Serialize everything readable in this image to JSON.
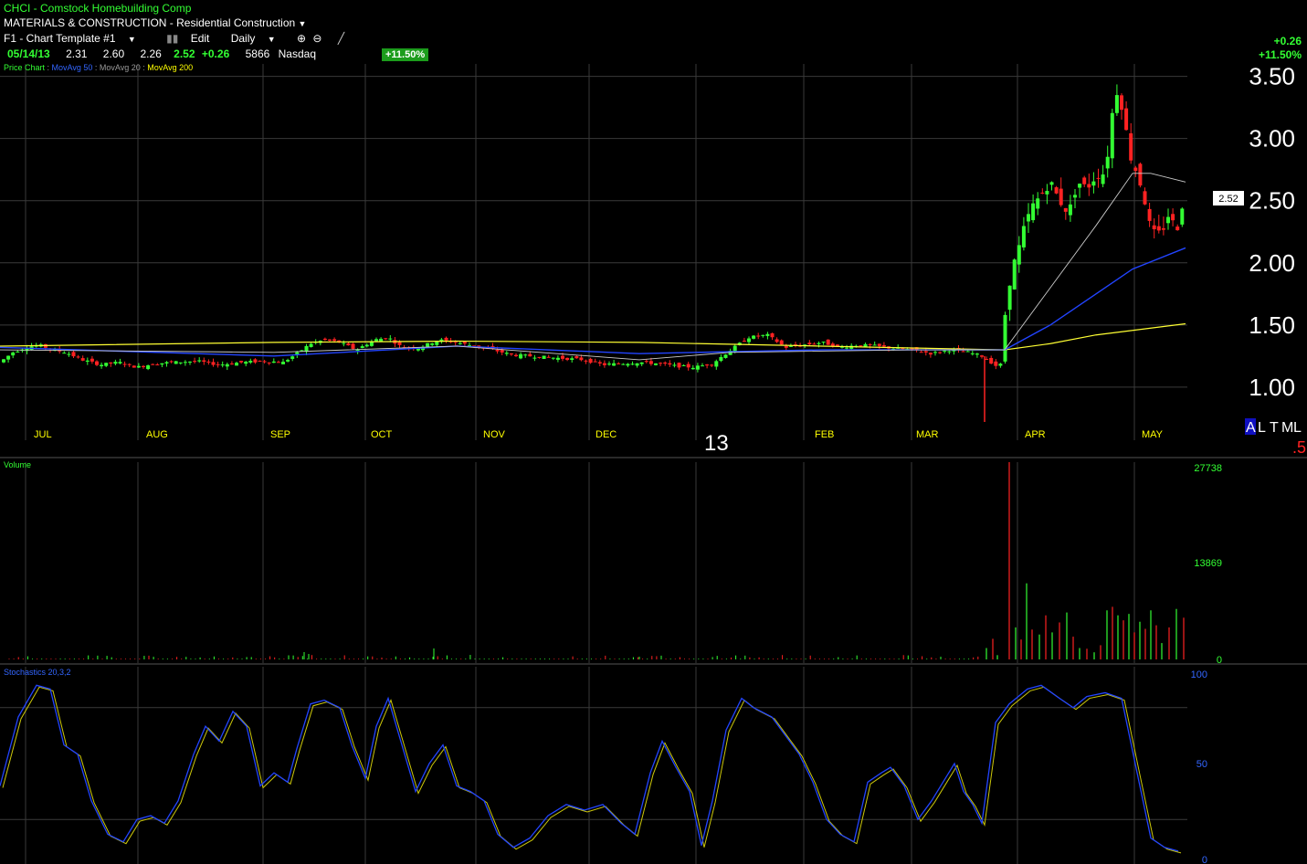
{
  "header": {
    "symbol_line": "CHCI - Comstock Homebuilding Comp",
    "sector_line": "MATERIALS & CONSTRUCTION - Residential Construction",
    "template": "F1 - Chart Template #1",
    "edit_label": "Edit",
    "period": "Daily",
    "date": "05/14/13",
    "open": "2.31",
    "high": "2.60",
    "low": "2.26",
    "close": "2.52",
    "change": "+0.26",
    "volume": "5866",
    "exchange": "Nasdaq",
    "pct_badge": "+11.50%",
    "right_change": "+0.26",
    "right_pct": "+11.50%"
  },
  "legend": {
    "price_chart": "Price Chart",
    "ma50": "MovAvg 50",
    "ma20": "MovAvg 20",
    "ma200": "MovAvg 200",
    "volume_label": "Volume",
    "stoch_label": "Stochastics 20,3,2"
  },
  "colors": {
    "up": "#33ff33",
    "down": "#ff2222",
    "ma50": "#2244ff",
    "ma20": "#cccccc",
    "ma200": "#ffff33",
    "grid": "#3a3a3a"
  },
  "axis": {
    "price_ticks": [
      "3.50",
      "3.00",
      "2.50",
      "2.00",
      "1.50",
      "1.00"
    ],
    "last_price_tag": "2.52",
    "months": [
      "JUL",
      "AUG",
      "SEP",
      "OCT",
      "NOV",
      "DEC",
      "FEB",
      "MAR",
      "APR",
      "MAY"
    ],
    "year_marker": "13",
    "scale_buttons": [
      "A",
      "L",
      "T",
      "M",
      "L"
    ],
    "scale_value": ".5",
    "volume_ticks": [
      "27738",
      "13869",
      "0"
    ],
    "stoch_ticks": [
      "100",
      "50",
      "0"
    ]
  },
  "chart_data": {
    "type": "candlestick",
    "price_range": [
      0.72,
      3.6
    ],
    "volume_range": [
      0,
      27738
    ],
    "stochastics_range": [
      0,
      100
    ],
    "price_path": [
      [
        0,
        1.2
      ],
      [
        14,
        1.28
      ],
      [
        28,
        1.32
      ],
      [
        42,
        1.34
      ],
      [
        58,
        1.3
      ],
      [
        72,
        1.28
      ],
      [
        90,
        1.22
      ],
      [
        110,
        1.18
      ],
      [
        130,
        1.2
      ],
      [
        150,
        1.16
      ],
      [
        170,
        1.19
      ],
      [
        190,
        1.2
      ],
      [
        215,
        1.21
      ],
      [
        240,
        1.18
      ],
      [
        265,
        1.2
      ],
      [
        290,
        1.21
      ],
      [
        310,
        1.2
      ],
      [
        325,
        1.27
      ],
      [
        340,
        1.35
      ],
      [
        355,
        1.38
      ],
      [
        372,
        1.36
      ],
      [
        390,
        1.3
      ],
      [
        410,
        1.38
      ],
      [
        425,
        1.4
      ],
      [
        440,
        1.32
      ],
      [
        460,
        1.32
      ],
      [
        480,
        1.38
      ],
      [
        500,
        1.36
      ],
      [
        520,
        1.33
      ],
      [
        540,
        1.3
      ],
      [
        560,
        1.26
      ],
      [
        580,
        1.25
      ],
      [
        600,
        1.24
      ],
      [
        620,
        1.23
      ],
      [
        640,
        1.22
      ],
      [
        660,
        1.18
      ],
      [
        680,
        1.19
      ],
      [
        700,
        1.2
      ],
      [
        720,
        1.19
      ],
      [
        740,
        1.17
      ],
      [
        760,
        1.16
      ],
      [
        780,
        1.19
      ],
      [
        800,
        1.3
      ],
      [
        820,
        1.4
      ],
      [
        840,
        1.42
      ],
      [
        860,
        1.32
      ],
      [
        880,
        1.34
      ],
      [
        900,
        1.36
      ],
      [
        920,
        1.32
      ],
      [
        940,
        1.34
      ],
      [
        960,
        1.33
      ],
      [
        980,
        1.31
      ],
      [
        1000,
        1.3
      ],
      [
        1020,
        1.27
      ],
      [
        1040,
        1.3
      ],
      [
        1060,
        1.28
      ],
      [
        1075,
        1.25
      ],
      [
        1085,
        1.2
      ],
      [
        1095,
        1.15
      ],
      [
        1102,
        1.7
      ],
      [
        1108,
        1.95
      ],
      [
        1115,
        2.1
      ],
      [
        1122,
        2.3
      ],
      [
        1130,
        2.45
      ],
      [
        1140,
        2.55
      ],
      [
        1150,
        2.65
      ],
      [
        1160,
        2.5
      ],
      [
        1170,
        2.4
      ],
      [
        1180,
        2.65
      ],
      [
        1190,
        2.6
      ],
      [
        1200,
        2.7
      ],
      [
        1208,
        2.72
      ],
      [
        1215,
        2.95
      ],
      [
        1220,
        3.4
      ],
      [
        1226,
        3.35
      ],
      [
        1232,
        3.1
      ],
      [
        1238,
        2.85
      ],
      [
        1245,
        2.72
      ],
      [
        1252,
        2.55
      ],
      [
        1258,
        2.32
      ],
      [
        1265,
        2.22
      ],
      [
        1272,
        2.25
      ],
      [
        1280,
        2.4
      ],
      [
        1288,
        2.25
      ],
      [
        1296,
        2.52
      ]
    ],
    "ma20_path": [
      [
        0,
        1.3
      ],
      [
        300,
        1.28
      ],
      [
        500,
        1.33
      ],
      [
        700,
        1.22
      ],
      [
        800,
        1.28
      ],
      [
        1000,
        1.3
      ],
      [
        1100,
        1.3
      ],
      [
        1150,
        1.8
      ],
      [
        1200,
        2.3
      ],
      [
        1240,
        2.72
      ],
      [
        1260,
        2.72
      ],
      [
        1298,
        2.65
      ]
    ],
    "ma50_path": [
      [
        0,
        1.32
      ],
      [
        300,
        1.25
      ],
      [
        500,
        1.33
      ],
      [
        700,
        1.27
      ],
      [
        900,
        1.3
      ],
      [
        1100,
        1.3
      ],
      [
        1150,
        1.5
      ],
      [
        1200,
        1.75
      ],
      [
        1240,
        1.95
      ],
      [
        1298,
        2.12
      ]
    ],
    "ma200_path": [
      [
        0,
        1.33
      ],
      [
        300,
        1.36
      ],
      [
        500,
        1.37
      ],
      [
        700,
        1.36
      ],
      [
        900,
        1.33
      ],
      [
        1100,
        1.3
      ],
      [
        1150,
        1.35
      ],
      [
        1200,
        1.42
      ],
      [
        1298,
        1.51
      ]
    ],
    "volume_spikes": [
      [
        1080,
        1600
      ],
      [
        1087,
        2900
      ],
      [
        1092,
        600
      ],
      [
        1105,
        27738
      ],
      [
        1112,
        4500
      ],
      [
        1118,
        2800
      ],
      [
        1124,
        10700
      ],
      [
        1130,
        4200
      ],
      [
        1138,
        3500
      ],
      [
        1145,
        6200
      ],
      [
        1152,
        3800
      ],
      [
        1160,
        5200
      ],
      [
        1168,
        6600
      ],
      [
        1175,
        3200
      ],
      [
        1182,
        1600
      ],
      [
        1190,
        1500
      ],
      [
        1198,
        1000
      ],
      [
        1205,
        2000
      ],
      [
        1212,
        6900
      ],
      [
        1218,
        7400
      ],
      [
        1224,
        6200
      ],
      [
        1230,
        5500
      ],
      [
        1236,
        6400
      ],
      [
        1242,
        3800
      ],
      [
        1248,
        5300
      ],
      [
        1254,
        4300
      ],
      [
        1260,
        6900
      ],
      [
        1266,
        4800
      ],
      [
        1272,
        2300
      ],
      [
        1280,
        4500
      ],
      [
        1288,
        7100
      ],
      [
        1296,
        5866
      ]
    ],
    "stochastics_path": [
      [
        0,
        38
      ],
      [
        20,
        75
      ],
      [
        40,
        92
      ],
      [
        55,
        90
      ],
      [
        70,
        60
      ],
      [
        85,
        55
      ],
      [
        100,
        30
      ],
      [
        118,
        12
      ],
      [
        135,
        8
      ],
      [
        150,
        20
      ],
      [
        165,
        22
      ],
      [
        180,
        18
      ],
      [
        195,
        30
      ],
      [
        212,
        55
      ],
      [
        225,
        70
      ],
      [
        240,
        62
      ],
      [
        255,
        78
      ],
      [
        270,
        70
      ],
      [
        285,
        38
      ],
      [
        300,
        45
      ],
      [
        315,
        40
      ],
      [
        325,
        58
      ],
      [
        340,
        82
      ],
      [
        355,
        84
      ],
      [
        372,
        80
      ],
      [
        385,
        60
      ],
      [
        400,
        42
      ],
      [
        412,
        70
      ],
      [
        425,
        85
      ],
      [
        440,
        60
      ],
      [
        455,
        35
      ],
      [
        470,
        50
      ],
      [
        485,
        60
      ],
      [
        500,
        38
      ],
      [
        515,
        35
      ],
      [
        530,
        30
      ],
      [
        545,
        12
      ],
      [
        562,
        5
      ],
      [
        580,
        10
      ],
      [
        600,
        22
      ],
      [
        620,
        28
      ],
      [
        640,
        25
      ],
      [
        660,
        28
      ],
      [
        680,
        18
      ],
      [
        695,
        12
      ],
      [
        712,
        45
      ],
      [
        725,
        62
      ],
      [
        740,
        48
      ],
      [
        755,
        35
      ],
      [
        768,
        6
      ],
      [
        780,
        30
      ],
      [
        795,
        68
      ],
      [
        812,
        85
      ],
      [
        825,
        80
      ],
      [
        845,
        75
      ],
      [
        860,
        65
      ],
      [
        875,
        55
      ],
      [
        890,
        40
      ],
      [
        905,
        20
      ],
      [
        920,
        12
      ],
      [
        935,
        8
      ],
      [
        950,
        40
      ],
      [
        965,
        45
      ],
      [
        975,
        48
      ],
      [
        990,
        38
      ],
      [
        1005,
        20
      ],
      [
        1020,
        30
      ],
      [
        1035,
        42
      ],
      [
        1045,
        50
      ],
      [
        1055,
        35
      ],
      [
        1065,
        28
      ],
      [
        1075,
        18
      ],
      [
        1090,
        72
      ],
      [
        1105,
        82
      ],
      [
        1125,
        90
      ],
      [
        1140,
        92
      ],
      [
        1160,
        85
      ],
      [
        1175,
        80
      ],
      [
        1190,
        86
      ],
      [
        1210,
        88
      ],
      [
        1228,
        85
      ],
      [
        1245,
        45
      ],
      [
        1260,
        10
      ],
      [
        1275,
        5
      ],
      [
        1290,
        3
      ]
    ]
  }
}
